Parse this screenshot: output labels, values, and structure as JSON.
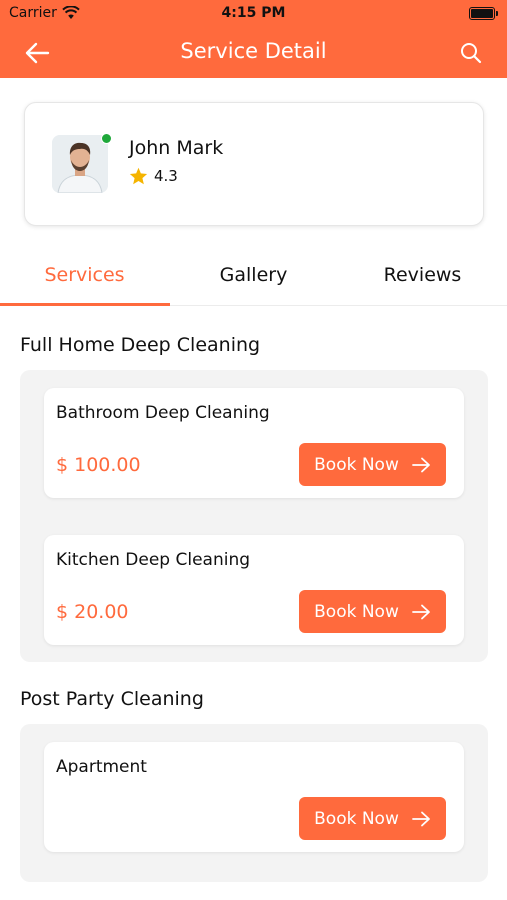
{
  "status_bar": {
    "carrier": "Carrier",
    "time": "4:15 PM"
  },
  "header": {
    "title": "Service Detail"
  },
  "provider": {
    "name": "John Mark",
    "rating": "4.3"
  },
  "tabs": [
    {
      "label": "Services",
      "active": true
    },
    {
      "label": "Gallery",
      "active": false
    },
    {
      "label": "Reviews",
      "active": false
    }
  ],
  "sections": [
    {
      "title": "Full Home Deep Cleaning",
      "services": [
        {
          "name": "Bathroom Deep Cleaning",
          "price": "$ 100.00",
          "button": "Book Now"
        },
        {
          "name": "Kitchen Deep Cleaning",
          "price": "$ 20.00",
          "button": "Book Now"
        }
      ]
    },
    {
      "title": "Post Party Cleaning",
      "services": [
        {
          "name": "Apartment",
          "price": "",
          "button": "Book Now"
        }
      ]
    }
  ],
  "colors": {
    "accent": "#FF6A3D",
    "online": "#1fa83a",
    "star": "#F5B400"
  }
}
